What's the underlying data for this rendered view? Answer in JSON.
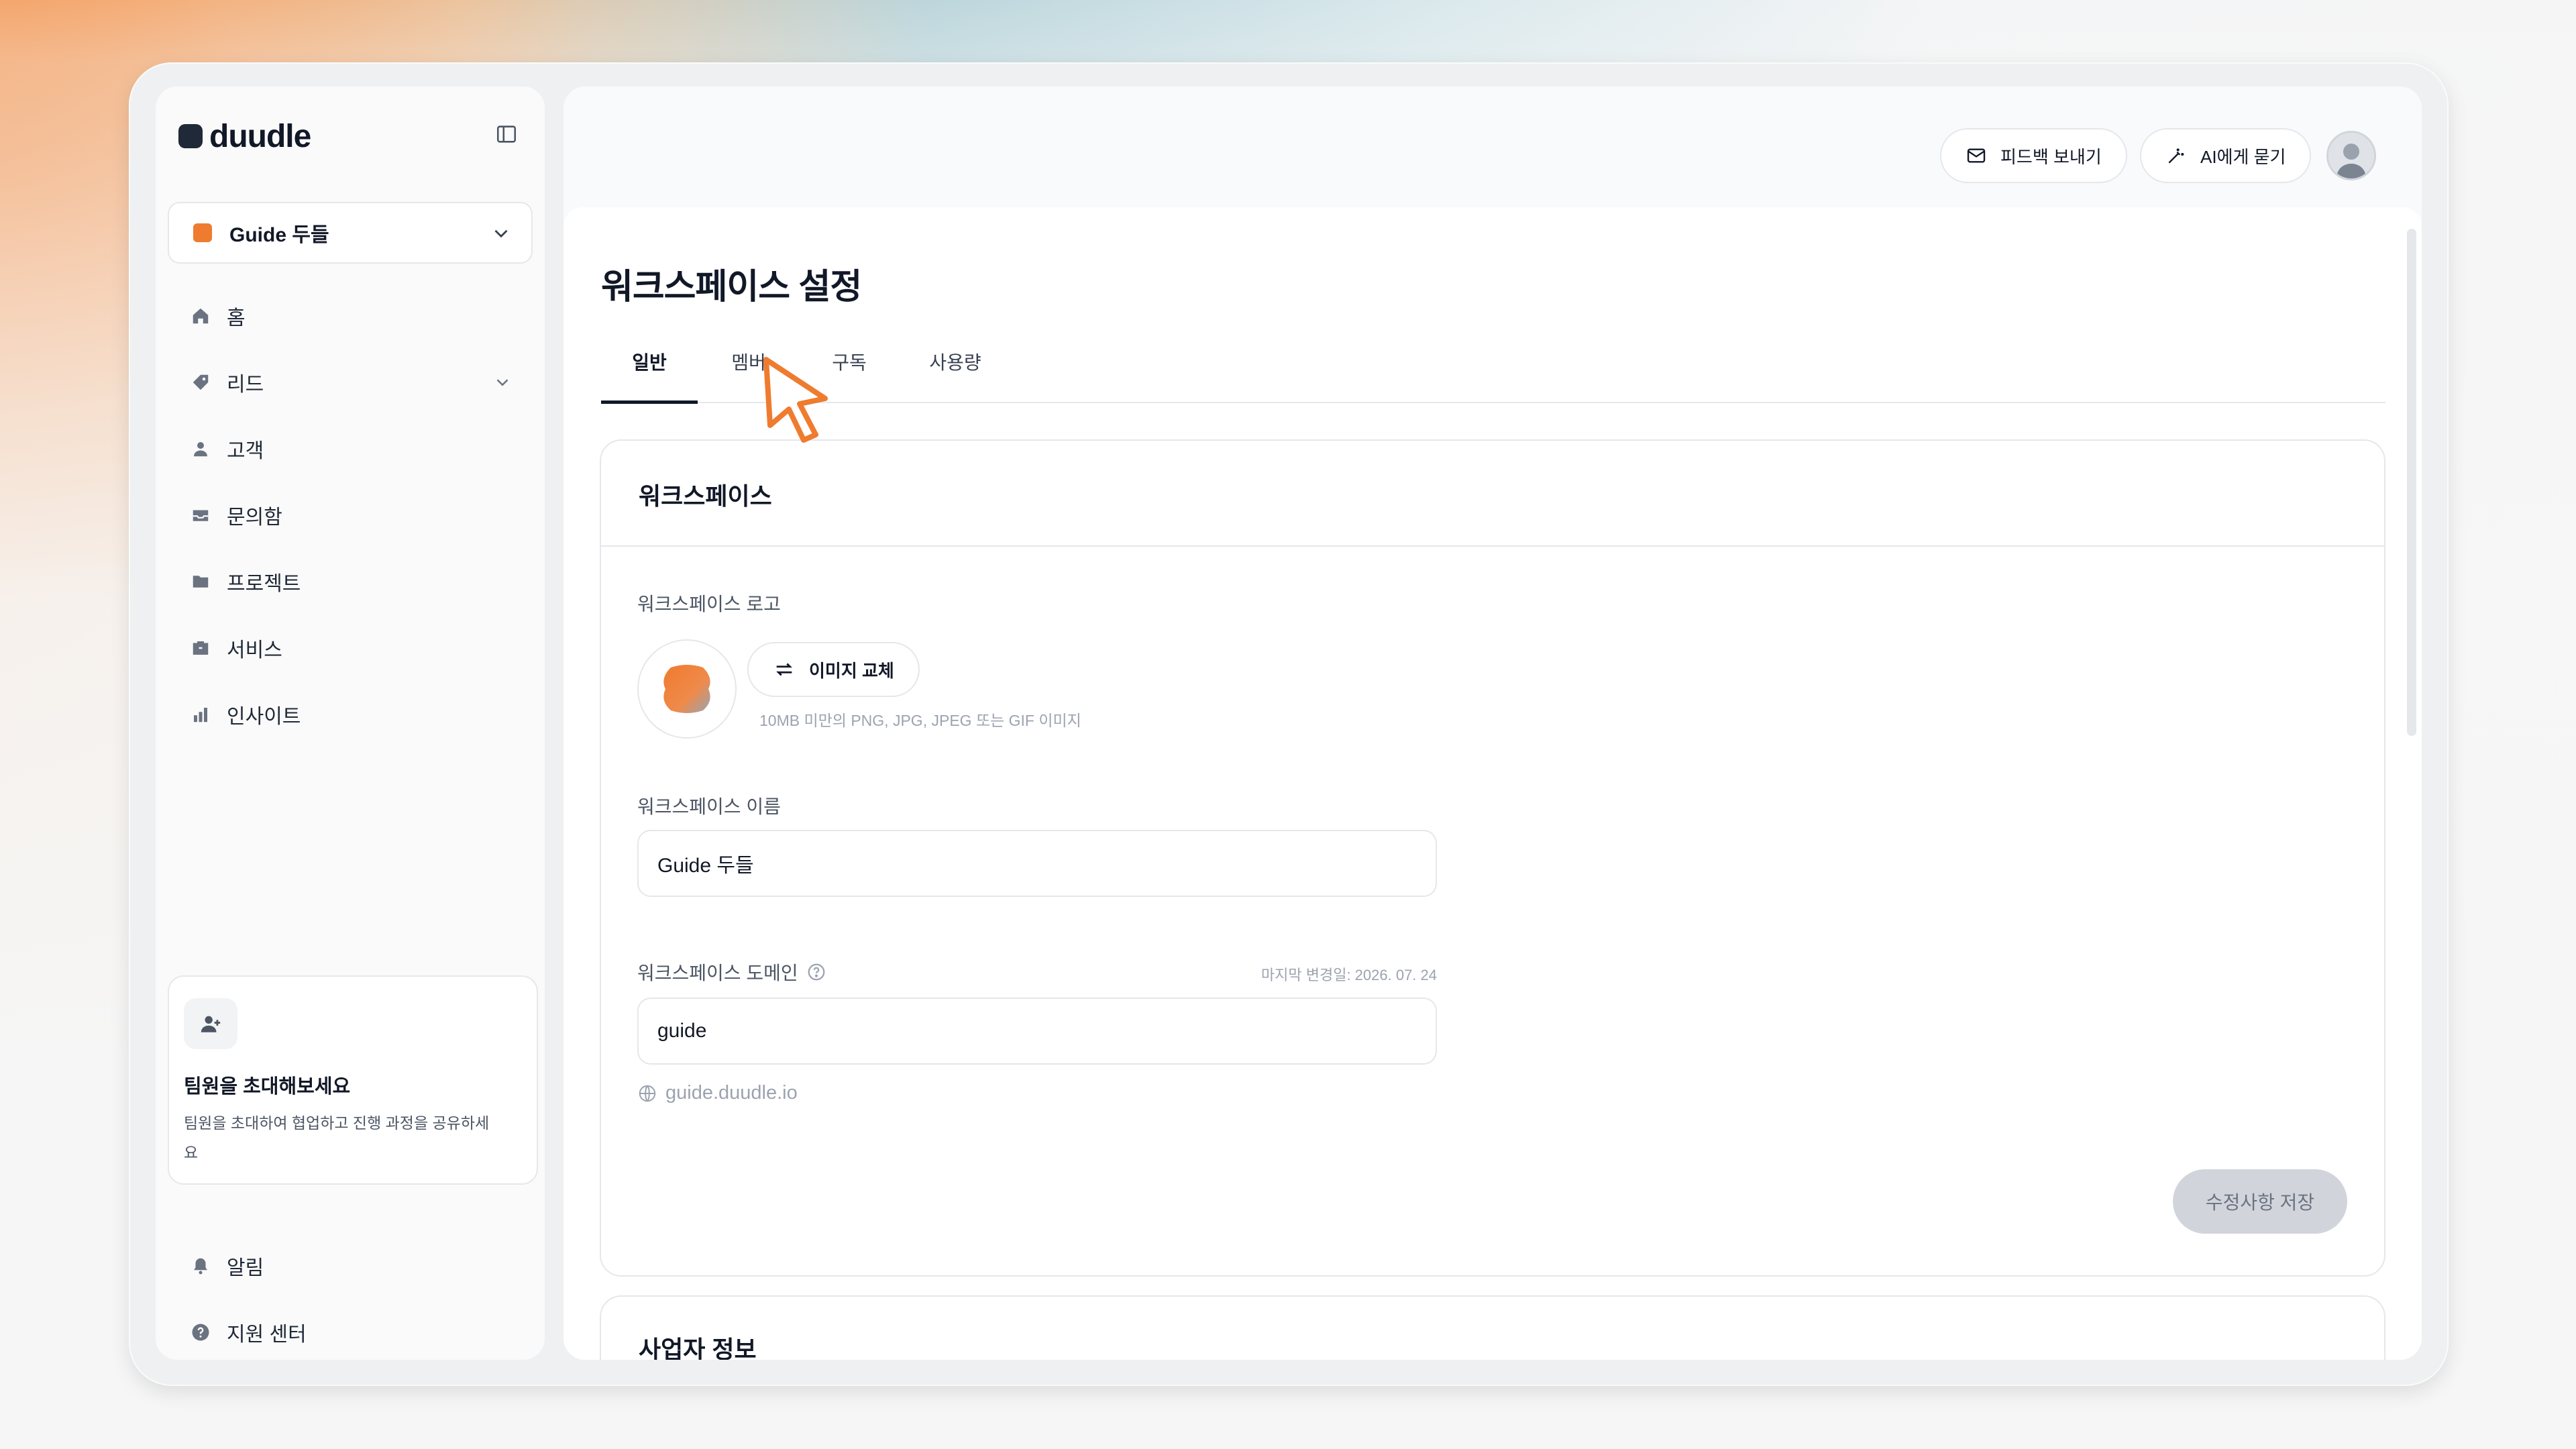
{
  "app": {
    "brand": "duudle",
    "workspace_selector": "Guide 두들"
  },
  "sidebar": {
    "items": [
      {
        "label": "홈",
        "icon": "home-icon"
      },
      {
        "label": "리드",
        "icon": "tag-icon",
        "expandable": true
      },
      {
        "label": "고객",
        "icon": "user-icon"
      },
      {
        "label": "문의함",
        "icon": "inbox-icon"
      },
      {
        "label": "프로젝트",
        "icon": "folder-icon"
      },
      {
        "label": "서비스",
        "icon": "briefcase-icon"
      },
      {
        "label": "인사이트",
        "icon": "bar-chart-icon"
      }
    ],
    "invite": {
      "title": "팀원을 초대해보세요",
      "description": "팀원을 초대하여 협업하고 진행 과정을 공유하세요"
    },
    "bottom_items": [
      {
        "label": "알림",
        "icon": "bell-icon"
      },
      {
        "label": "지원 센터",
        "icon": "help-icon"
      }
    ]
  },
  "topbar": {
    "feedback_label": "피드백 보내기",
    "ask_ai_label": "AI에게 묻기"
  },
  "page": {
    "title": "워크스페이스 설정",
    "tabs": [
      {
        "label": "일반",
        "active": true
      },
      {
        "label": "멤버",
        "active": false
      },
      {
        "label": "구독",
        "active": false
      },
      {
        "label": "사용량",
        "active": false
      }
    ]
  },
  "workspace_card": {
    "title": "워크스페이스",
    "logo_label": "워크스페이스 로고",
    "replace_image_label": "이미지 교체",
    "logo_hint": "10MB 미만의 PNG, JPG, JPEG 또는 GIF 이미지",
    "name_label": "워크스페이스 이름",
    "name_value": "Guide 두들",
    "domain_label": "워크스페이스 도메인",
    "last_changed": "마지막 변경일: 2026. 07. 24",
    "domain_value": "guide",
    "domain_url": "guide.duudle.io",
    "save_label": "수정사항 저장"
  },
  "business_card": {
    "title": "사업자 정보"
  },
  "colors": {
    "accent": "#EF7B2F",
    "save_disabled": "#D1D5DB",
    "text_primary": "#111827"
  }
}
